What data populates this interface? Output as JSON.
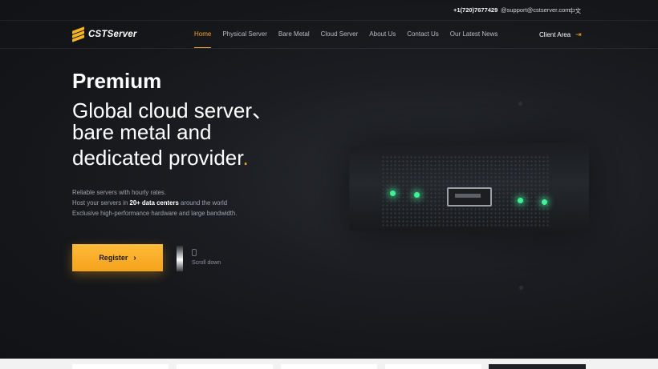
{
  "topbar": {
    "phone": "+1(720)7677429",
    "email": "@support@cstserver.com",
    "language": "中文"
  },
  "nav": {
    "logo_text": "CSTServer",
    "items": [
      {
        "label": "Home",
        "active": true
      },
      {
        "label": "Physical Server",
        "active": false
      },
      {
        "label": "Bare Metal",
        "active": false
      },
      {
        "label": "Cloud Server",
        "active": false
      },
      {
        "label": "About Us",
        "active": false
      },
      {
        "label": "Contact Us",
        "active": false
      },
      {
        "label": "Our Latest News",
        "active": false
      }
    ],
    "client_area": "Client Area",
    "client_icon": "login-arrow-icon"
  },
  "hero": {
    "headline_bold": "Premium",
    "headline_line1": "Global cloud server、",
    "headline_line2": "bare metal and",
    "headline_line3": "dedicated provider",
    "headline_dot": ".",
    "desc_line1": "Reliable servers with hourly rates.",
    "desc_line2_prefix": "Host your servers in ",
    "desc_line2_bold": "20+ data centers",
    "desc_line2_suffix": " around the world",
    "desc_line3": "Exclusive high-performance hardware and large bandwidth.",
    "register_label": "Register",
    "register_arrow": "›",
    "scroll_label": "Scroll down"
  },
  "colors": {
    "accent": "#f5a524",
    "background": "#15171b",
    "led": "#3ff29a"
  }
}
